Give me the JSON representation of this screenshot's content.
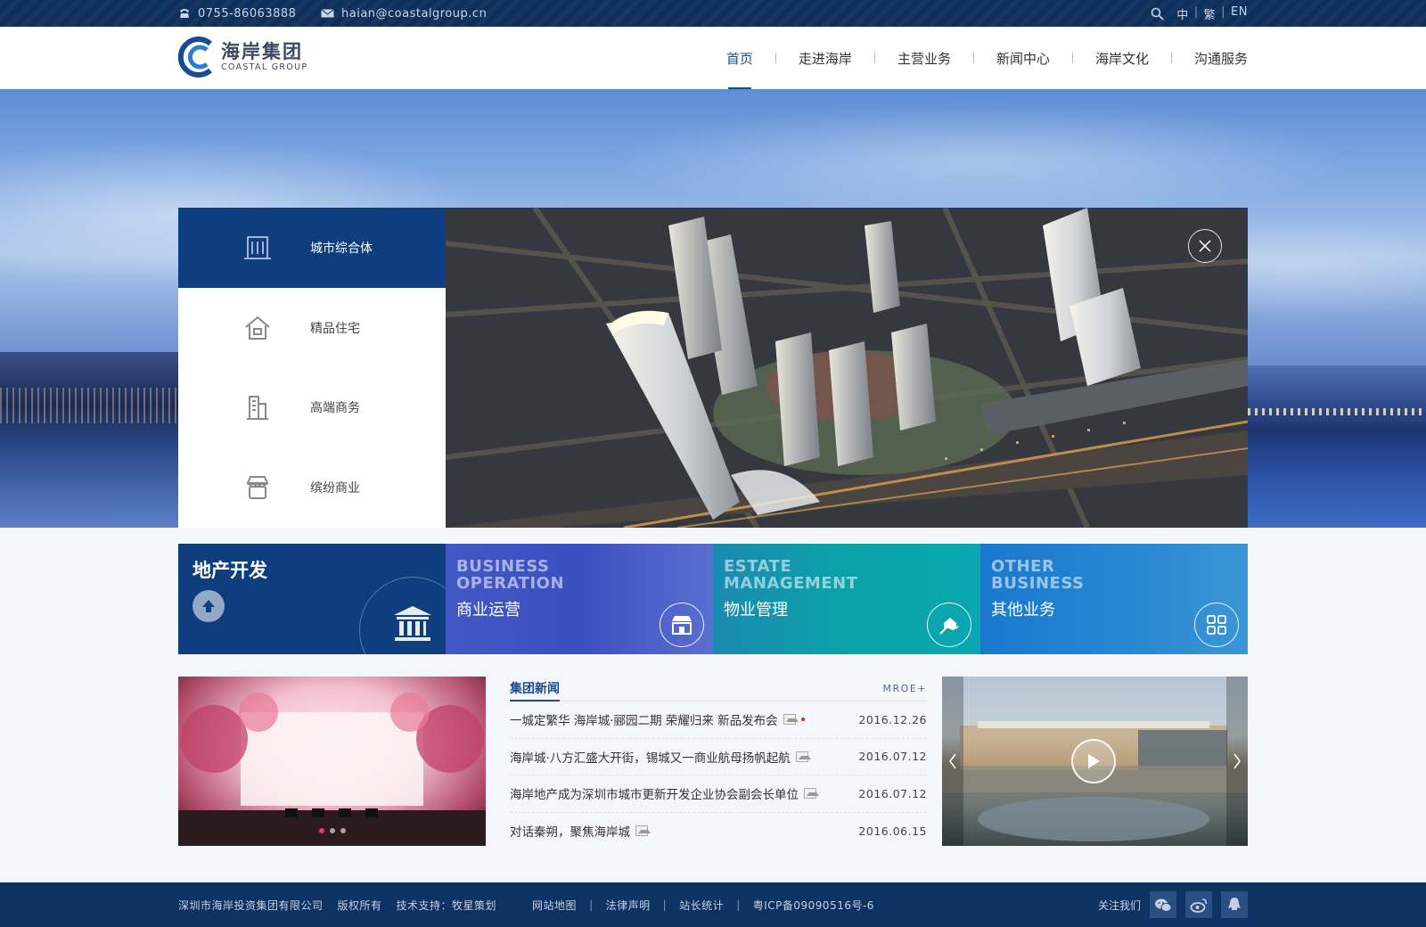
{
  "topbar": {
    "phone": "0755-86063888",
    "email": "haian@coastalgroup.cn",
    "lang": [
      "中",
      "繁",
      "EN"
    ]
  },
  "header": {
    "logo_cn": "海岸集团",
    "logo_en": "COASTAL GROUP",
    "nav": [
      "首页",
      "走进海岸",
      "主营业务",
      "新闻中心",
      "海岸文化",
      "沟通服务"
    ],
    "active_nav": "首页"
  },
  "hero": {
    "menu": [
      {
        "label": "城市综合体",
        "icon": "building-icon",
        "active": true
      },
      {
        "label": "精品住宅",
        "icon": "house-icon",
        "active": false
      },
      {
        "label": "高端商务",
        "icon": "office-tower-icon",
        "active": false
      },
      {
        "label": "缤纷商业",
        "icon": "shop-icon",
        "active": false
      }
    ]
  },
  "tiles": [
    {
      "en": "",
      "cn": "地产开发",
      "icon": "bank-icon"
    },
    {
      "en1": "BUSINESS",
      "en2": "OPERATION",
      "cn": "商业运营",
      "icon": "store-icon"
    },
    {
      "en1": "ESTATE",
      "en2": "MANAGEMENT",
      "cn": "物业管理",
      "icon": "hand-house-icon"
    },
    {
      "en1": "OTHER",
      "en2": "BUSINESS",
      "cn": "其他业务",
      "icon": "grid-icon"
    }
  ],
  "news": {
    "title": "集团新闻",
    "more": "MROE+",
    "items": [
      {
        "title": "一城定繁华 海岸城·郦园二期 荣耀归来 新品发布会",
        "date": "2016.12.26",
        "is_new": true
      },
      {
        "title": "海岸城·八方汇盛大开街，锡城又一商业航母扬帆起航",
        "date": "2016.07.12",
        "is_new": false
      },
      {
        "title": "海岸地产成为深圳市城市更新开发企业协会副会长单位",
        "date": "2016.07.12",
        "is_new": false
      },
      {
        "title": "对话秦朔，聚焦海岸城",
        "date": "2016.06.15",
        "is_new": false
      }
    ]
  },
  "footer": {
    "company": "深圳市海岸投资集团有限公司",
    "rights": "版权所有",
    "tech": "技术支持：牧星策划",
    "links": [
      "网站地图",
      "法律声明",
      "站长统计",
      "粤ICP备09090516号-6"
    ],
    "follow": "关注我们"
  },
  "colors": {
    "brand_dark": "#0e3e7e",
    "topbar": "#0d2f5c",
    "footer": "#0e3362",
    "tile_business": "#4258c4",
    "tile_estate": "#0aa3a8",
    "tile_other": "#1a78cf"
  }
}
